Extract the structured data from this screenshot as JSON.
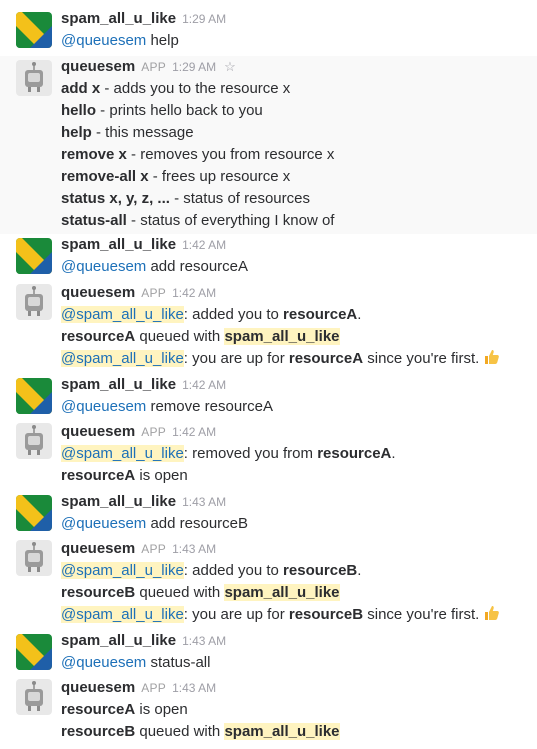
{
  "users": {
    "human": "spam_all_u_like",
    "bot": "queuesem",
    "app_badge": "APP"
  },
  "colors": {
    "avatar_green": "#1a8a3a",
    "avatar_yellow": "#f3c11a",
    "avatar_blue": "#1f5fa8",
    "mention": "#1d70b8",
    "highlight": "#fff4c0"
  },
  "messages": {
    "m1": {
      "time": "1:29 AM",
      "mention": "@queuesem",
      "text": " help"
    },
    "m2": {
      "time": "1:29 AM",
      "star_icon": "star-outline-icon",
      "lines": [
        {
          "cmd": "add x",
          "desc": " - adds you to the resource x"
        },
        {
          "cmd": "hello",
          "desc": " - prints hello back to you"
        },
        {
          "cmd": "help",
          "desc": " - this message"
        },
        {
          "cmd": "remove x",
          "desc": " - removes you from resource x"
        },
        {
          "cmd": "remove-all x",
          "desc": " - frees up resource x"
        },
        {
          "cmd": "status x, y, z, ...",
          "desc": " - status of resources"
        },
        {
          "cmd": "status-all",
          "desc": " - status of everything I know of"
        }
      ]
    },
    "m3": {
      "time": "1:42 AM",
      "mention": "@queuesem",
      "text": " add resourceA"
    },
    "m4": {
      "time": "1:42 AM",
      "l1_mention": "@spam_all_u_like",
      "l1_a": ": added you to ",
      "l1_b": "resourceA",
      "l1_c": ".",
      "l2_a": "resourceA",
      "l2_b": " queued with ",
      "l2_c": "spam_all_u_like",
      "l3_mention": "@spam_all_u_like",
      "l3_a": ": you are up for ",
      "l3_b": "resourceA",
      "l3_c": " since you're first.",
      "emoji": "thumbs-up-icon"
    },
    "m5": {
      "time": "1:42 AM",
      "mention": "@queuesem",
      "text": " remove resourceA"
    },
    "m6": {
      "time": "1:42 AM",
      "l1_mention": "@spam_all_u_like",
      "l1_a": ": removed you from ",
      "l1_b": "resourceA",
      "l1_c": ".",
      "l2_a": "resourceA",
      "l2_b": " is open"
    },
    "m7": {
      "time": "1:43 AM",
      "mention": "@queuesem",
      "text": " add resourceB"
    },
    "m8": {
      "time": "1:43 AM",
      "l1_mention": "@spam_all_u_like",
      "l1_a": ": added you to ",
      "l1_b": "resourceB",
      "l1_c": ".",
      "l2_a": "resourceB",
      "l2_b": " queued with ",
      "l2_c": "spam_all_u_like",
      "l3_mention": "@spam_all_u_like",
      "l3_a": ": you are up for ",
      "l3_b": "resourceB",
      "l3_c": " since you're first.",
      "emoji": "thumbs-up-icon"
    },
    "m9": {
      "time": "1:43 AM",
      "mention": "@queuesem",
      "text": " status-all"
    },
    "m10": {
      "time": "1:43 AM",
      "l1_a": "resourceA",
      "l1_b": " is open",
      "l2_a": "resourceB",
      "l2_b": " queued with ",
      "l2_c": "spam_all_u_like"
    }
  }
}
